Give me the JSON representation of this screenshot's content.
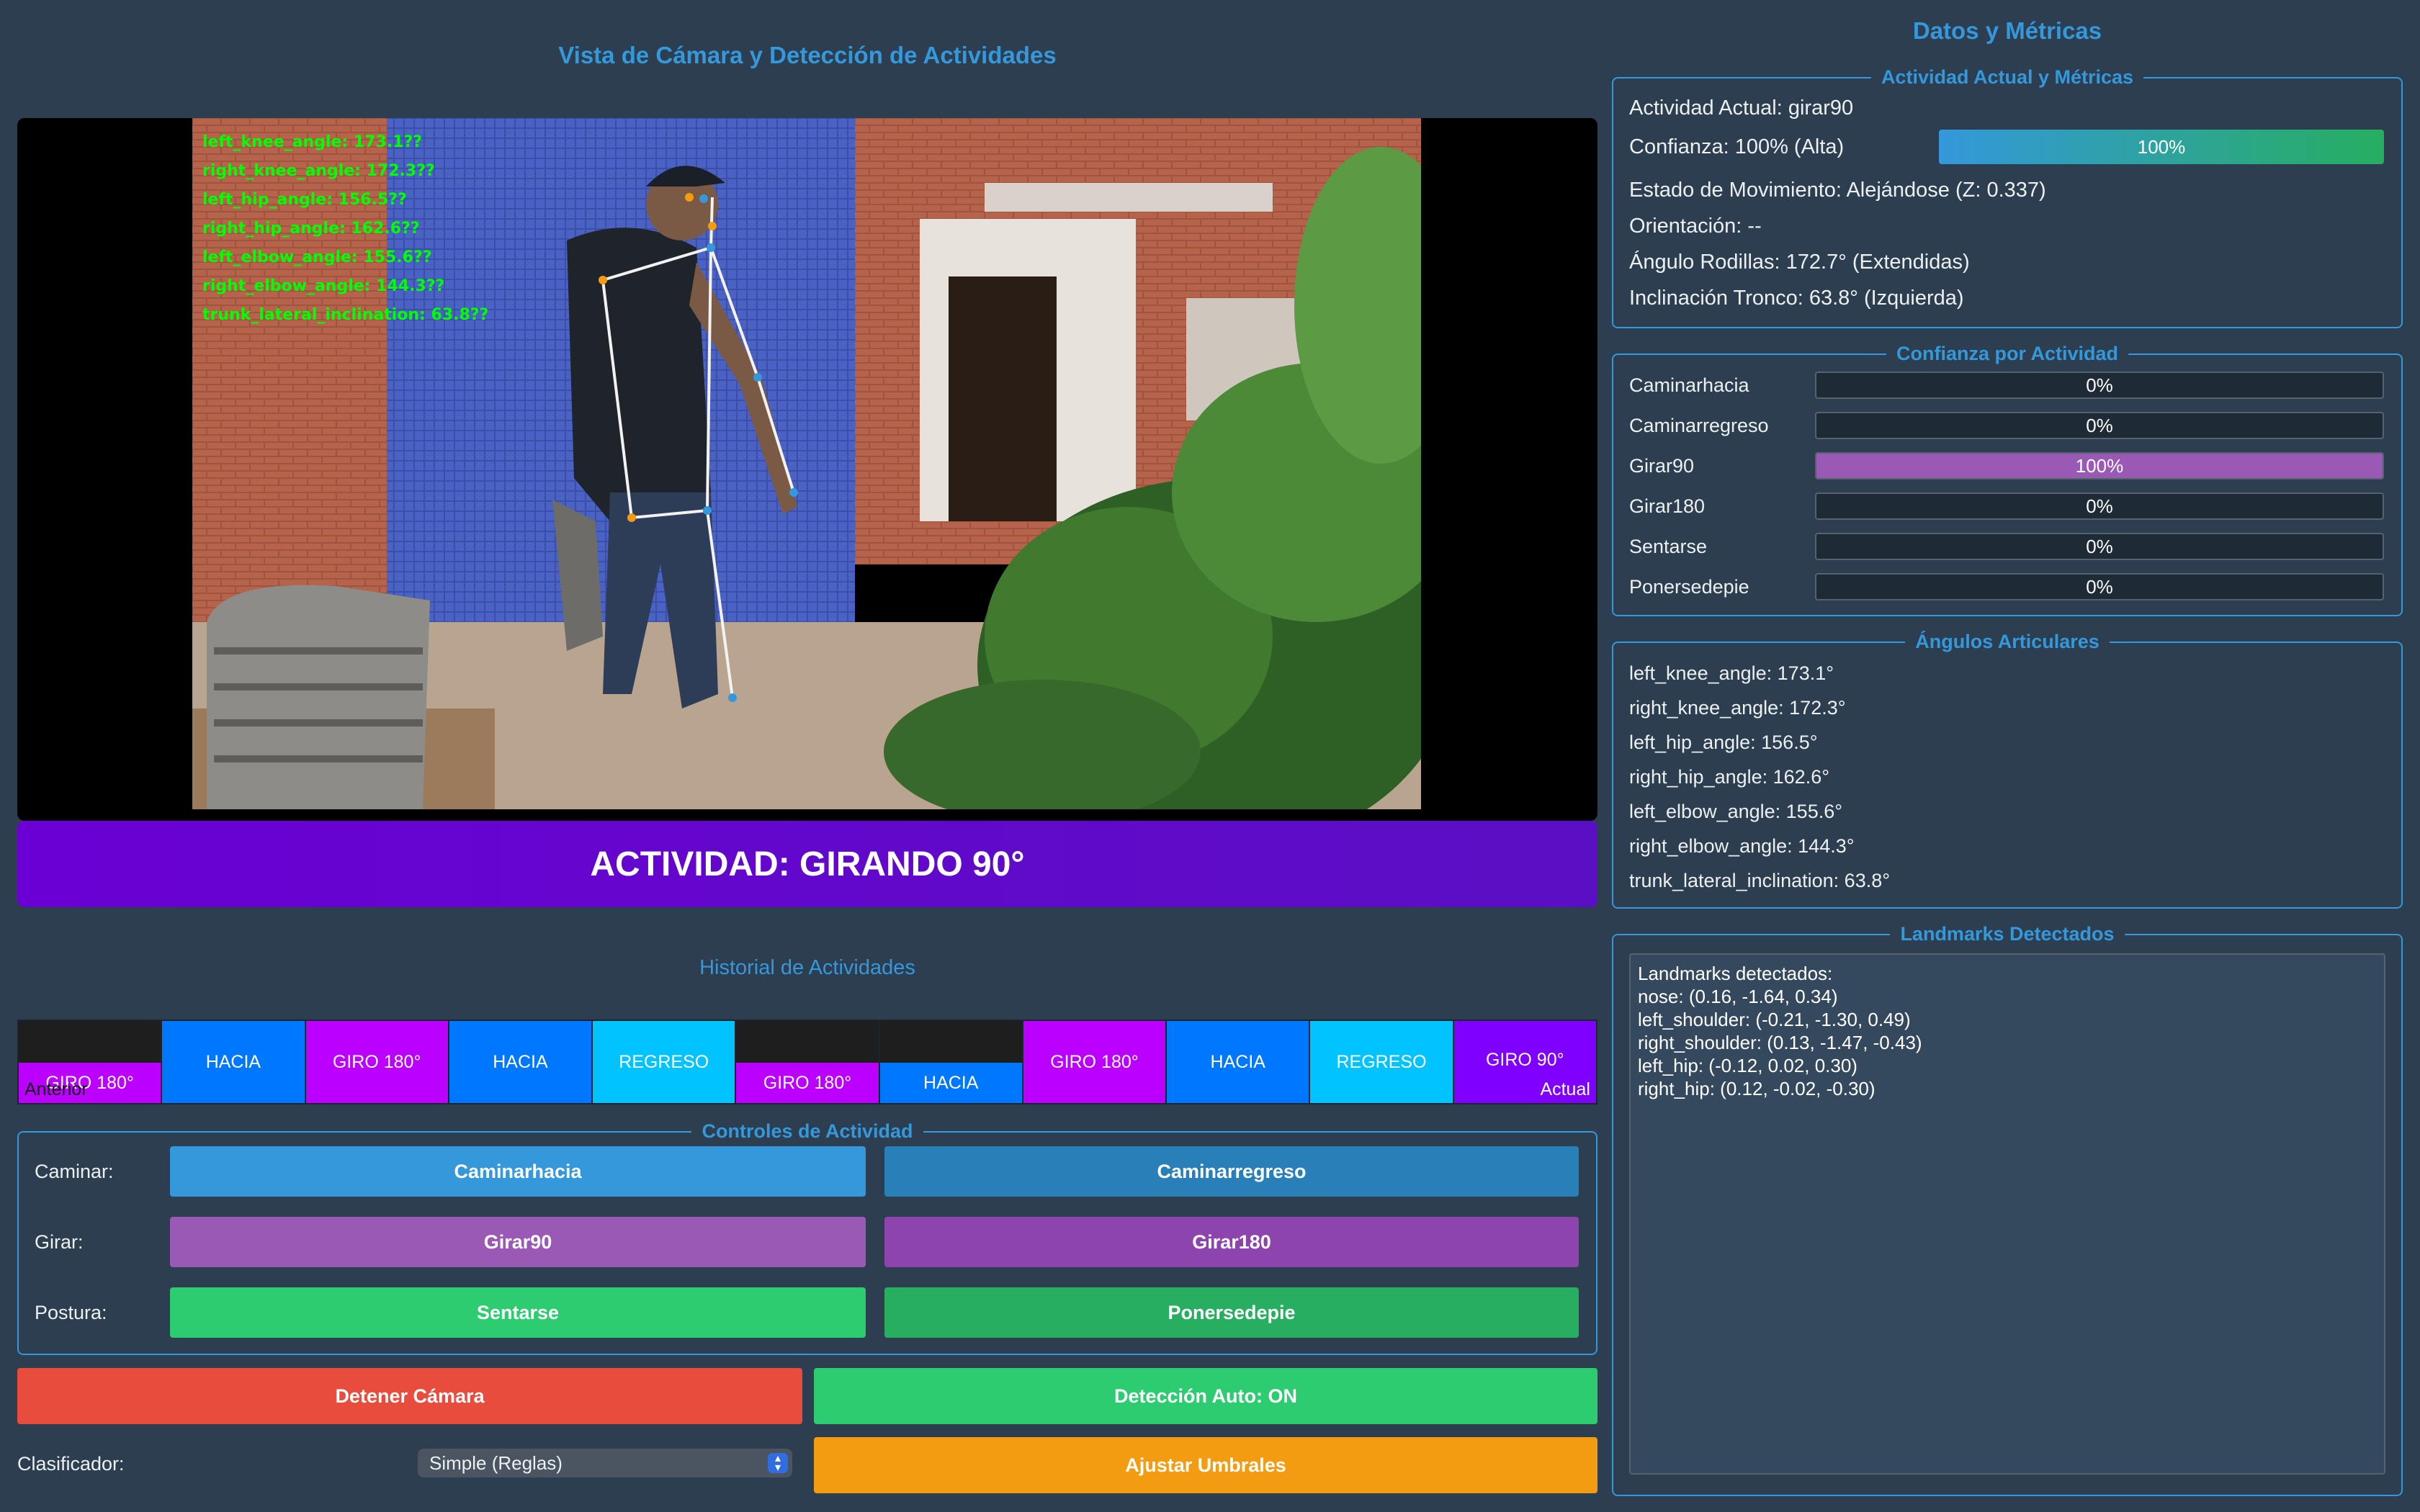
{
  "left_panel": {
    "title": "Vista de Cámara y Detección de Actividades",
    "overlay_angles": [
      "left_knee_angle: 173.1??",
      "right_knee_angle: 172.3??",
      "left_hip_angle: 156.5??",
      "right_hip_angle: 162.6??",
      "left_elbow_angle: 155.6??",
      "right_elbow_angle: 144.3??",
      "trunk_lateral_inclination: 63.8??"
    ],
    "activity_banner": "ACTIVIDAD: GIRANDO 90°",
    "history_title": "Historial de Actividades",
    "history": [
      {
        "label": "GIRO 180°",
        "note": "Anterior"
      },
      {
        "label": "HACIA"
      },
      {
        "label": "GIRO 180°"
      },
      {
        "label": "HACIA"
      },
      {
        "label": "REGRESO"
      },
      {
        "label": "GIRO 180°"
      },
      {
        "label": "HACIA"
      },
      {
        "label": "GIRO 180°"
      },
      {
        "label": "HACIA"
      },
      {
        "label": "REGRESO"
      },
      {
        "label": "GIRO 90°",
        "note": "Actual"
      }
    ],
    "controls": {
      "legend": "Controles de Actividad",
      "rows": [
        {
          "label": "Caminar:",
          "buttons": [
            "Caminarhacia",
            "Caminarregreso"
          ]
        },
        {
          "label": "Girar:",
          "buttons": [
            "Girar90",
            "Girar180"
          ]
        },
        {
          "label": "Postura:",
          "buttons": [
            "Sentarse",
            "Ponersedepie"
          ]
        }
      ]
    },
    "stop_camera": "Detener Cámara",
    "auto_detection": "Detección Auto: ON",
    "classifier_label": "Clasificador:",
    "classifier_value": "Simple (Reglas)",
    "adjust_thresholds": "Ajustar Umbrales"
  },
  "right_panel": {
    "title": "Datos y Métricas",
    "current": {
      "legend": "Actividad Actual y Métricas",
      "activity": "Actividad Actual: girar90",
      "confidence": "Confianza: 100% (Alta)",
      "confidence_value": 100,
      "confidence_text": "100%",
      "movement": "Estado de Movimiento: Alejándose (Z: 0.337)",
      "orientation": "Orientación: --",
      "knees": "Ángulo Rodillas: 172.7° (Extendidas)",
      "trunk": "Inclinación Tronco: 63.8° (Izquierda)"
    },
    "per_activity": {
      "legend": "Confianza por Actividad",
      "items": [
        {
          "name": "Caminarhacia",
          "value": 0,
          "text": "0%"
        },
        {
          "name": "Caminarregreso",
          "value": 0,
          "text": "0%"
        },
        {
          "name": "Girar90",
          "value": 100,
          "text": "100%"
        },
        {
          "name": "Girar180",
          "value": 0,
          "text": "0%"
        },
        {
          "name": "Sentarse",
          "value": 0,
          "text": "0%"
        },
        {
          "name": "Ponersedepie",
          "value": 0,
          "text": "0%"
        }
      ]
    },
    "angles": {
      "legend": "Ángulos Articulares",
      "items": [
        "left_knee_angle: 173.1°",
        "right_knee_angle: 172.3°",
        "left_hip_angle: 156.5°",
        "right_hip_angle: 162.6°",
        "left_elbow_angle: 155.6°",
        "right_elbow_angle: 144.3°",
        "trunk_lateral_inclination: 63.8°"
      ]
    },
    "landmarks": {
      "legend": "Landmarks Detectados",
      "lines": [
        "Landmarks detectados:",
        "nose: (0.16, -1.64, 0.34)",
        "left_shoulder: (-0.21, -1.30, 0.49)",
        "right_shoulder: (0.13, -1.47, -0.43)",
        "left_hip: (-0.12, 0.02, 0.30)",
        "right_hip: (0.12, -0.02, -0.30)"
      ]
    }
  },
  "colors": {
    "background": "#2c3e50",
    "accent": "#3498db",
    "walk": "#3498db",
    "turn": "#9b59b6",
    "posture": "#2ecc71",
    "stop": "#e74c3c",
    "auto": "#2ecc71",
    "adjust": "#f39c12"
  }
}
